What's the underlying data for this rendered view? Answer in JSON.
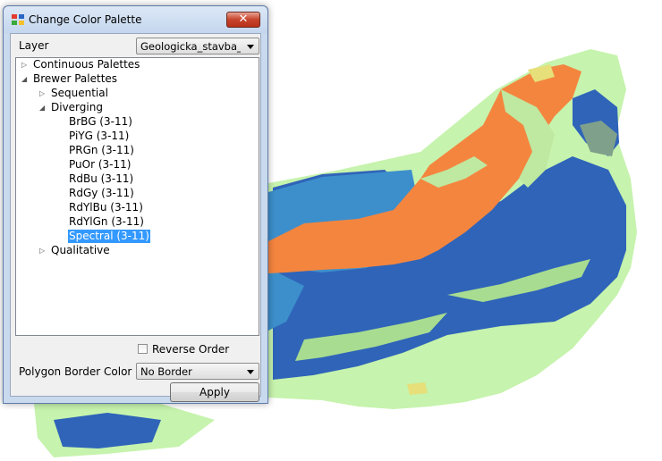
{
  "window": {
    "title": "Change Color Palette",
    "close_glyph": "✕",
    "icon": "palette-app-icon"
  },
  "layer": {
    "label": "Layer",
    "value": "Geologicka_stavba_W("
  },
  "tree": {
    "continuous": "Continuous Palettes",
    "brewer": "Brewer Palettes",
    "sequential": "Sequential",
    "diverging": "Diverging",
    "qualitative": "Qualitative",
    "diverging_items": [
      "BrBG (3-11)",
      "PiYG (3-11)",
      "PRGn (3-11)",
      "PuOr (3-11)",
      "RdBu (3-11)",
      "RdGy (3-11)",
      "RdYlBu (3-11)",
      "RdYlGn (3-11)",
      "Spectral (3-11)"
    ],
    "selected": "Spectral (3-11)"
  },
  "reverse_order": {
    "label": "Reverse Order",
    "checked": false
  },
  "border": {
    "label": "Polygon Border Color",
    "value": "No Border"
  },
  "apply_label": "Apply",
  "colors": {
    "selection": "#3399ff",
    "map_blue": "#2b63b8",
    "map_mid_blue": "#3f8fcc",
    "map_orange": "#f4843f",
    "map_light_green": "#bff0a5",
    "map_green": "#a8dc90",
    "map_yellow": "#e8e07a",
    "map_gray_green": "#7fa08a"
  }
}
